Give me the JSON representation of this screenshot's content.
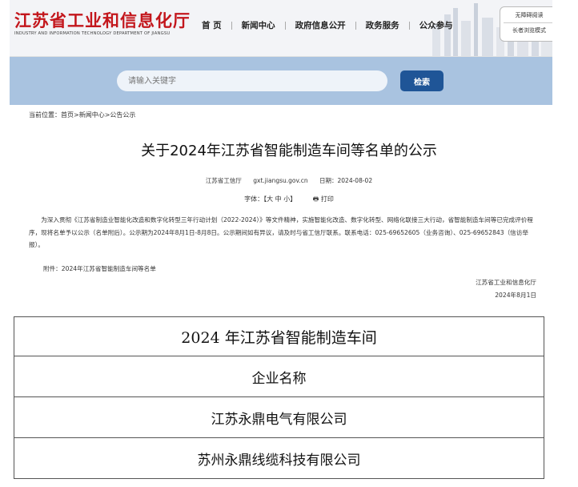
{
  "header": {
    "logo_title": "江苏省工业和信息化厅",
    "logo_subtitle": "INDUSTRY AND INFORMATION TECHNOLOGY DEPARTMENT OF JIANGSU",
    "nav": [
      "首 页",
      "新闻中心",
      "政府信息公开",
      "政务服务",
      "公众参与"
    ],
    "accessibility": [
      "无障碍阅读",
      "长者浏览模式"
    ]
  },
  "search": {
    "placeholder": "请输入关键字",
    "button": "检索"
  },
  "breadcrumb": {
    "label": "当前位置：",
    "items": [
      "首页",
      "新闻中心",
      "公告公示"
    ],
    "sep": ">"
  },
  "article": {
    "title": "关于2024年江苏省智能制造车间等名单的公示",
    "source": "江苏省工信厅",
    "site": "gxt.jiangsu.gov.cn",
    "date": "日期：2024-08-02",
    "font_label": "字体：【",
    "font_sizes": [
      "大",
      "中",
      "小"
    ],
    "font_end": "】",
    "print": "打印",
    "body": "为深入贯彻《江苏省制造业智能化改造和数字化转型三年行动计划（2022-2024）》等文件精神，实施智能化改造、数字化转型、网络化联接三大行动，省智能制造车间等已完成评价程序，现将名单予以公示（名单附后）。公示期为2024年8月1日-8月8日。公示期间如有异议，请及时与省工信厅联系。联系电话：025-69652605（业务咨询）、025-69652843（信访举报）。",
    "attachment": "附件：2024年江苏省智能制造车间等名单",
    "signature": "江苏省工业和信息化厅",
    "sign_date": "2024年8月1日"
  },
  "table": {
    "title": "2024 年江苏省智能制造车间",
    "header": "企业名称",
    "rows": [
      "江苏永鼎电气有限公司",
      "苏州永鼎线缆科技有限公司"
    ]
  },
  "colors": {
    "brand_red": "#c3161c",
    "search_band": "#a9c3e0",
    "search_button": "#1f5597"
  }
}
